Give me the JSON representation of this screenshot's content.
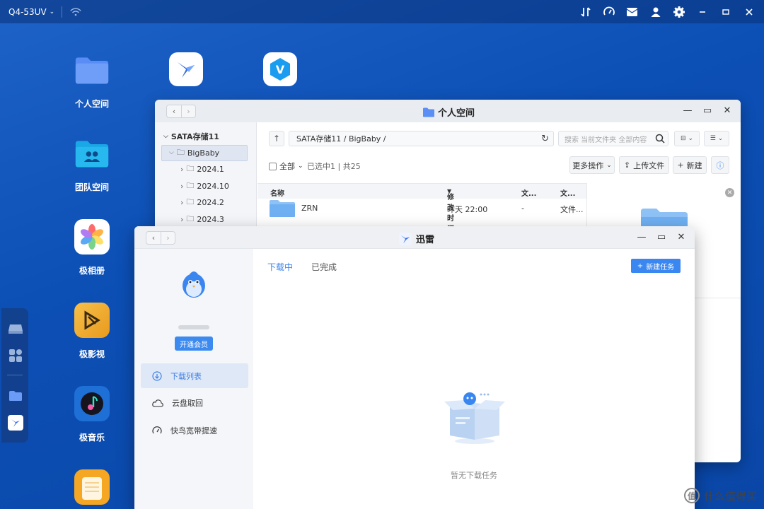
{
  "topbar": {
    "device": "Q4-53UV"
  },
  "desktop": {
    "icons": [
      {
        "label": "个人空间"
      },
      {
        "label": "团队空间"
      },
      {
        "label": "极相册"
      },
      {
        "label": "极影视"
      },
      {
        "label": "极音乐"
      }
    ],
    "app_v_letter": "V"
  },
  "file_window": {
    "title": "个人空间",
    "tree": {
      "root": "SATA存储11",
      "selected": "BigBaby",
      "children": [
        "2024.1",
        "2024.10",
        "2024.2",
        "2024.3"
      ]
    },
    "path": "SATA存储11 / BigBaby /",
    "search_placeholder": "搜索 当前文件夹 全部内容",
    "select_all": "全部",
    "selection_info": "已选中1 | 共25",
    "buttons": {
      "more": "更多操作",
      "upload": "上传文件",
      "new": "新建"
    },
    "columns": {
      "name": "名称",
      "modified": "修改时间",
      "col3": "文...",
      "col4": "文..."
    },
    "rows": [
      {
        "name": "ZRN",
        "modified": "昨天 22:00",
        "col3": "-",
        "col4": "文件..."
      }
    ]
  },
  "xunlei": {
    "title": "迅雷",
    "vip_button": "开通会员",
    "nav": {
      "download_list": "下载列表",
      "cloud_fetch": "云盘取回",
      "bird_speed": "快鸟宽带提速"
    },
    "tabs": {
      "downloading": "下载中",
      "completed": "已完成"
    },
    "new_task": "新建任务",
    "empty_text": "暂无下载任务"
  },
  "watermark": {
    "glyph": "值",
    "text": "什么值得买"
  },
  "colors": {
    "accent": "#3b87f1",
    "desktop_bg": "#0c4fb5"
  }
}
